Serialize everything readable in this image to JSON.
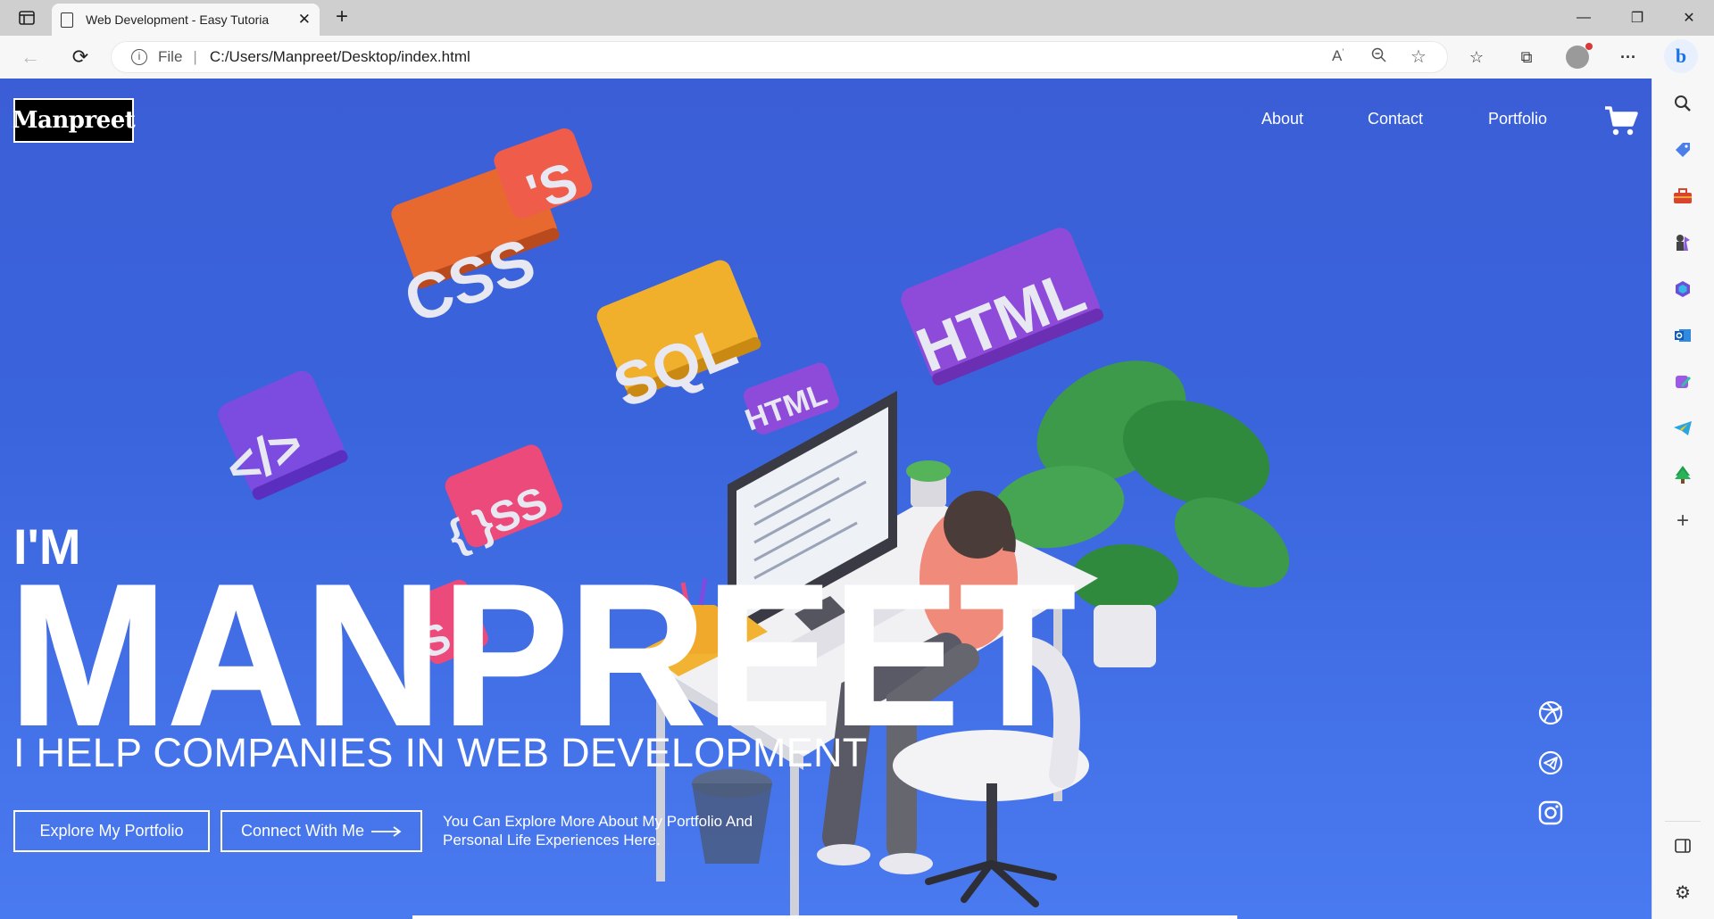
{
  "browser": {
    "tab_title": "Web Development - Easy Tutoria",
    "address_scheme": "File",
    "address_url": "C:/Users/Manpreet/Desktop/index.html",
    "sidebar_icons": [
      "search-icon",
      "tag-icon",
      "briefcase-icon",
      "chess-icon",
      "microsoft365-icon",
      "outlook-icon",
      "designer-icon",
      "telegram-icon",
      "tree-icon",
      "add-icon",
      "sidebar-toggle-icon",
      "settings-icon"
    ]
  },
  "page": {
    "logo": "Manpreet",
    "nav": {
      "about": "About",
      "contact": "Contact",
      "portfolio": "Portfolio"
    },
    "hero": {
      "intro": "I'M",
      "name": "MANPREET",
      "tagline": "I HELP COMPANIES IN WEB DEVELOPMENT",
      "explore_button": "Explore My Portfolio",
      "connect_button": "Connect With Me",
      "blurb": "You Can Explore More About My Portfolio And Personal Life Experiences Here."
    },
    "social_icons": [
      "dribbble-icon",
      "telegram-icon",
      "instagram-icon"
    ],
    "colors": {
      "background": "#3b5ed6",
      "text": "#ffffff",
      "logo_bg": "#000000"
    }
  }
}
